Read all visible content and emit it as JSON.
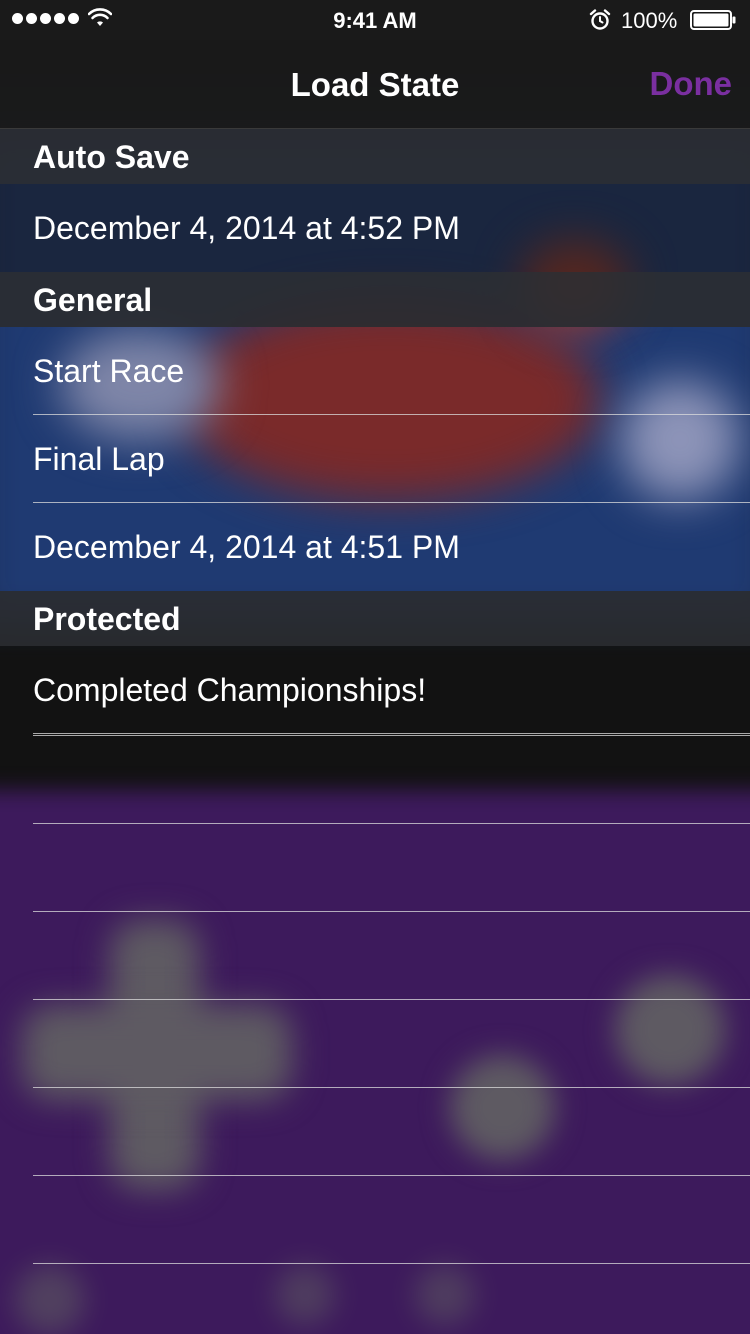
{
  "status_bar": {
    "time": "9:41 AM",
    "battery_percent": "100%",
    "signal_bars": 5,
    "icons": [
      "signal-dots-icon",
      "wifi-icon",
      "alarm-icon",
      "battery-icon"
    ]
  },
  "nav": {
    "title": "Load State",
    "done_label": "Done"
  },
  "colors": {
    "accent": "#7a2fa0",
    "nav_background": "#1a1a1a",
    "section_header_background": "#2a2c30",
    "text": "#ffffff"
  },
  "sections": [
    {
      "header": "Auto Save",
      "rows": [
        "December 4, 2014 at 4:52 PM"
      ]
    },
    {
      "header": "General",
      "rows": [
        "Start Race",
        "Final Lap",
        "December 4, 2014 at 4:51 PM"
      ]
    },
    {
      "header": "Protected",
      "rows": [
        "Completed Championships!"
      ]
    }
  ]
}
